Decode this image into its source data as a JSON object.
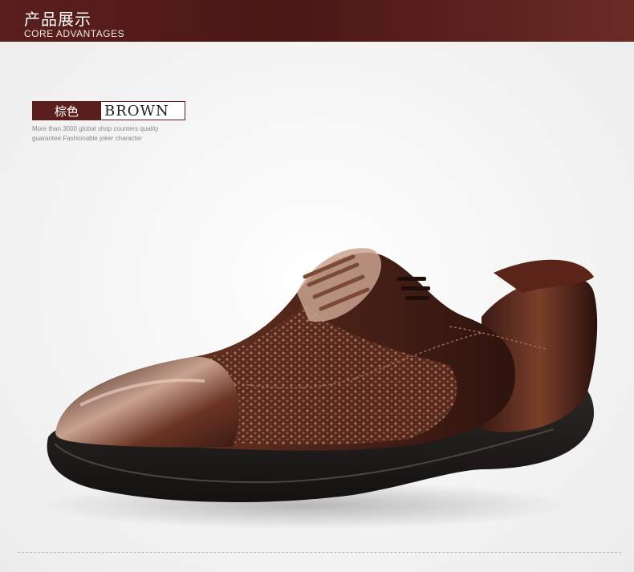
{
  "header": {
    "title": "产品展示",
    "subtitle": "CORE ADVANTAGES"
  },
  "color_tag": {
    "label_cn": "棕色",
    "label_en": "BROWN"
  },
  "description": {
    "line1": "More than 3000 global shop counters quality",
    "line2": "guarantee  Fashionable joker character"
  },
  "product": {
    "icon": "leather-oxford-shoe",
    "colors": {
      "brand": "#5a1f1c",
      "leather_dark": "#3b1a14",
      "leather_mid": "#6b3423",
      "leather_highlight": "#c9a28f",
      "sole": "#1e1b1a"
    }
  }
}
